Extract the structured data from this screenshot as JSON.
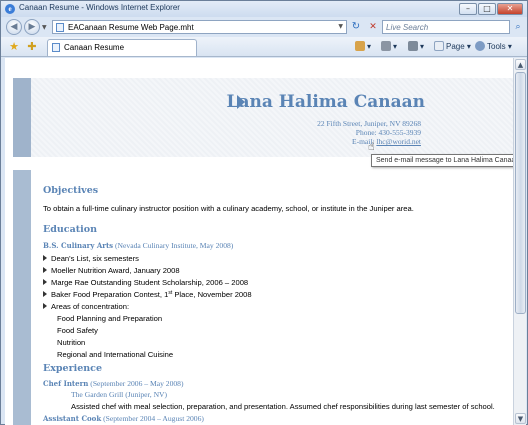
{
  "window": {
    "title": "Canaan Resume - Windows Internet Explorer",
    "minimize": "–",
    "maximize": "□",
    "close": "✕"
  },
  "address_bar": {
    "url": "EACanaan Resume Web Page.mht",
    "search_placeholder": "Live Search"
  },
  "tab": {
    "label": "Canaan Resume"
  },
  "toolbar": {
    "page": "Page",
    "tools": "Tools"
  },
  "resume": {
    "name": "Lana Halima Canaan",
    "address": "22 Fifth Street, Juniper, NV 89268",
    "phone_label": "Phone:",
    "phone": "430-555-3939",
    "email_label": "E-mail:",
    "email": "lhc@worid.net",
    "tooltip": "Send e-mail message to Lana Halima Canaan",
    "objectives_heading": "Objectives",
    "objective_text": "To obtain a full-time culinary instructor position with a culinary academy, school, or institute in the Juniper area.",
    "education_heading": "Education",
    "degree": "B.S. Culinary Arts",
    "degree_detail": " (Nevada Culinary Institute, May 2008)",
    "edu_items": [
      "Dean's List, six semesters",
      "Moeller Nutrition Award, January 2008",
      "Marge Rae Outstanding Student Scholarship, 2006 – 2008",
      "Baker Food Preparation Contest, 1",
      "st",
      " Place, November 2008",
      "Areas of concentration:"
    ],
    "concentrations": [
      "Food Planning and Preparation",
      "Food Safety",
      "Nutrition",
      "Regional and International Cuisine"
    ],
    "experience_heading": "Experience",
    "job1_title": "Chef Intern",
    "job1_dates": " (September 2006 – May 2008)",
    "job1_employer": "The Garden Grill (Juniper, NV)",
    "job1_desc": "Assisted chef with meal selection, preparation, and presentation. Assumed chef responsibilities during last semester of school.",
    "job2_title": "Assistant Cook",
    "job2_dates": " (September 2004 – August 2006)"
  },
  "colors": {
    "heading": "#5a84b5",
    "sidebar_bar": "#9fb3cb",
    "chrome": "#dbe6f4"
  }
}
